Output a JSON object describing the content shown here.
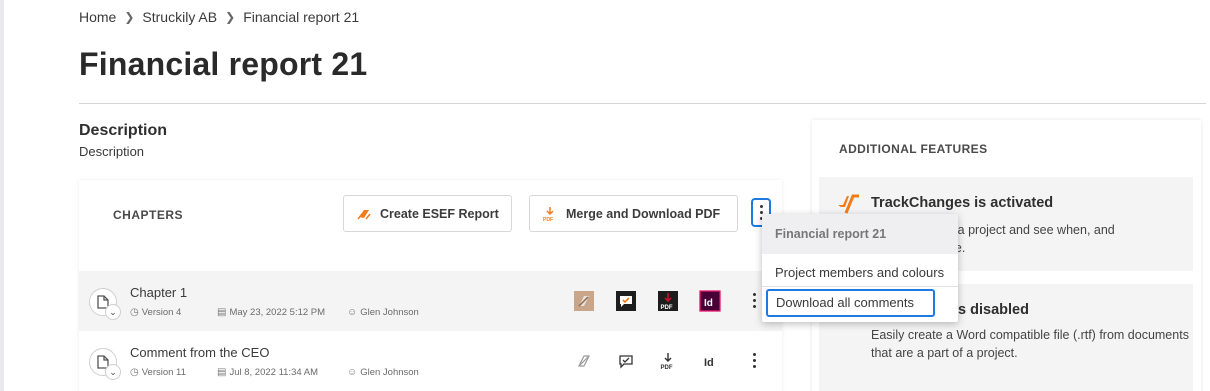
{
  "breadcrumb": {
    "items": [
      "Home",
      "Struckily AB",
      "Financial report 21"
    ],
    "separator": ">"
  },
  "page": {
    "title": "Financial report 21"
  },
  "description": {
    "heading": "Description",
    "text": "Description"
  },
  "chapters": {
    "label": "CHAPTERS",
    "buttons": {
      "esef": "Create ESEF Report",
      "merge": "Merge and Download PDF"
    },
    "rows": [
      {
        "title": "Chapter 1",
        "version": "Version 4",
        "date": "May 23, 2022 5:12 PM",
        "user": "Glen Johnson",
        "icons_active": true
      },
      {
        "title": "Comment from the CEO",
        "version": "Version 11",
        "date": "Jul 8, 2022 11:34 AM",
        "user": "Glen Johnson",
        "icons_active": false
      }
    ]
  },
  "menu": {
    "header": "Financial report 21",
    "items": [
      "Project members and colours",
      "Download all comments"
    ],
    "highlighted": "Download all comments"
  },
  "features": {
    "heading": "ADDITIONAL FEATURES",
    "items": [
      {
        "title": "TrackChanges is activated",
        "text": "hanges in a project and see when, and\nwere made."
      },
      {
        "title": "is disabled",
        "text": "Easily create a Word compatible file (.rtf) from documents that are a part of a project."
      }
    ]
  },
  "colors": {
    "accent_blue": "#1f7ae0",
    "brand_orange": "#f07d1a",
    "pdf_red": "#c8102e",
    "indesign_magenta": "#e8196b",
    "indesign_bg": "#470137"
  },
  "icons": [
    "chevron-right-icon",
    "esef-icon",
    "pdf-icon",
    "kebab-icon",
    "document-icon",
    "chevron-down-icon",
    "version-icon",
    "calendar-icon",
    "user-icon",
    "esef-export-icon",
    "comment-export-icon",
    "pdf-export-icon",
    "indesign-export-icon",
    "trackchanges-icon"
  ]
}
